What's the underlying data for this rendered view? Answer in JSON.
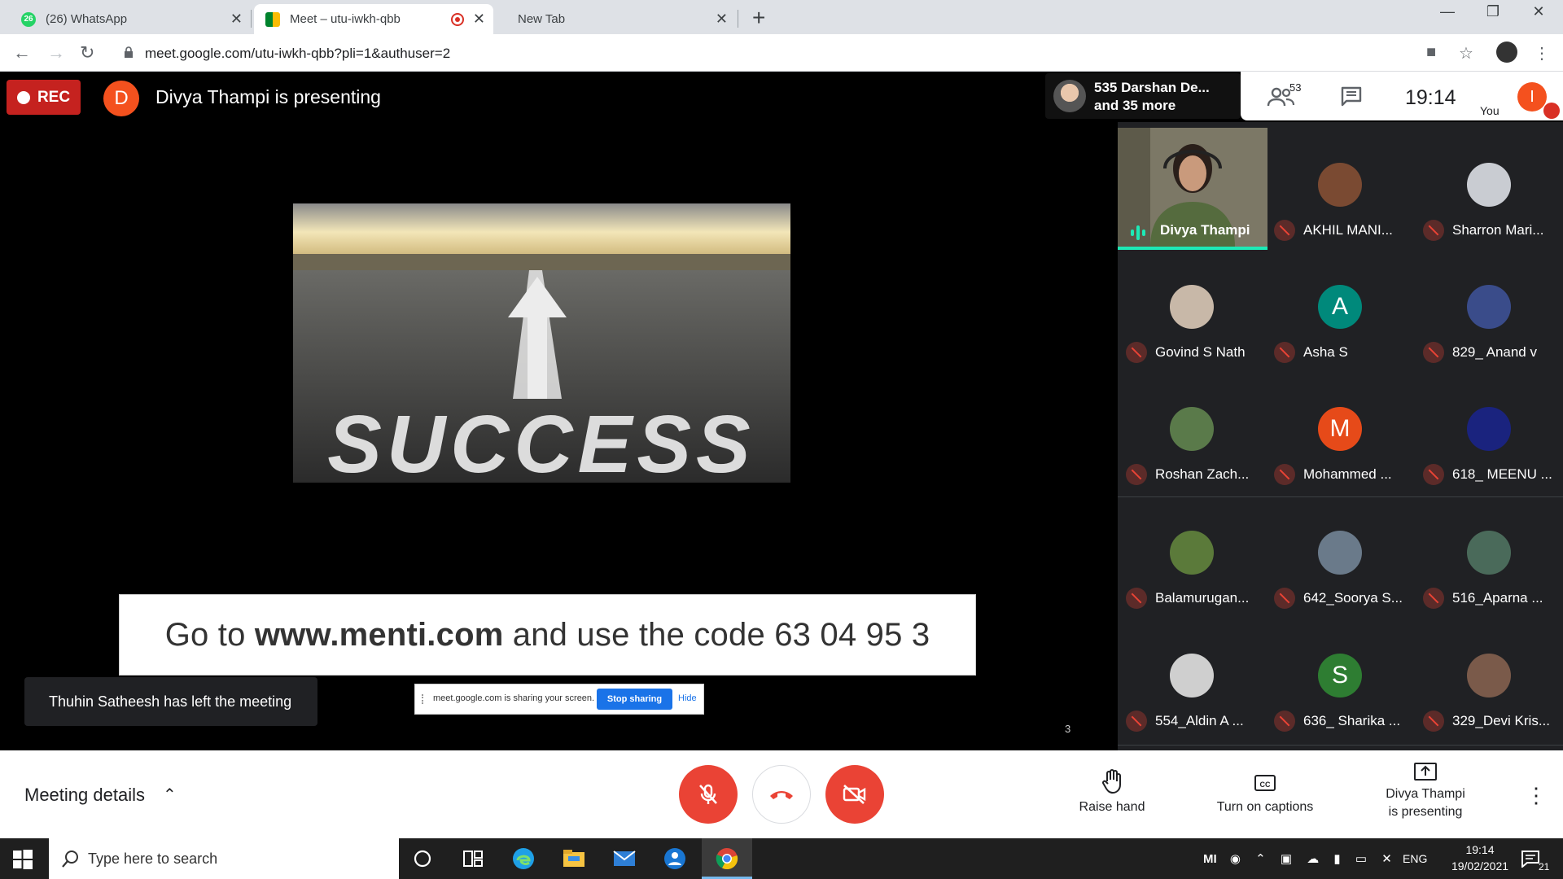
{
  "browser": {
    "tabs": [
      {
        "title": "(26) WhatsApp",
        "badge": "26"
      },
      {
        "title": "Meet – utu-iwkh-qbb"
      },
      {
        "title": "New Tab"
      }
    ],
    "url": "meet.google.com/utu-iwkh-qbb?pli=1&authuser=2"
  },
  "meet": {
    "rec_label": "REC",
    "presenter_initial": "D",
    "presenting_title": "Divya Thampi is presenting",
    "attendee_name": "535 Darshan De...",
    "attendee_more": "and 35 more",
    "people_count": "53",
    "clock": "19:14",
    "you_label": "You",
    "you_initial": "I"
  },
  "slide": {
    "banner_prefix": "Go to ",
    "banner_url": "www.menti.com",
    "banner_mid": " and use the code ",
    "banner_code": "63 04 95 3",
    "slide_number": "3",
    "image_word": "SUCCESS"
  },
  "toast": "Thuhin Satheesh has left the meeting",
  "share_bar": {
    "text": "meet.google.com is sharing your screen.",
    "stop": "Stop sharing",
    "hide": "Hide"
  },
  "speaker": {
    "name": "Divya Thampi"
  },
  "participants": [
    {
      "name": "AKHIL MANI...",
      "initial": "",
      "color": "#7a4a32"
    },
    {
      "name": "Sharron Mari...",
      "initial": "",
      "color": "#c9ccd2"
    },
    {
      "name": "Govind S Nath",
      "initial": "",
      "color": "#c8b8a8"
    },
    {
      "name": "Asha S",
      "initial": "A",
      "color": "#00897b"
    },
    {
      "name": "829_ Anand v",
      "initial": "",
      "color": "#3a4c8a"
    },
    {
      "name": "Roshan Zach...",
      "initial": "",
      "color": "#5a7a4a"
    },
    {
      "name": "Mohammed ...",
      "initial": "M",
      "color": "#e64a19"
    },
    {
      "name": "618_ MEENU ...",
      "initial": "",
      "color": "#1a237e"
    },
    {
      "name": "Balamurugan...",
      "initial": "",
      "color": "#5b7a3a"
    },
    {
      "name": "642_Soorya S...",
      "initial": "",
      "color": "#6a7a8a"
    },
    {
      "name": "516_Aparna ...",
      "initial": "",
      "color": "#4a6a5a"
    },
    {
      "name": "554_Aldin A ...",
      "initial": "",
      "color": "#cfcfcf"
    },
    {
      "name": "636_ Sharika ...",
      "initial": "S",
      "color": "#2e7d32"
    },
    {
      "name": "329_Devi Kris...",
      "initial": "",
      "color": "#7a5a4a"
    }
  ],
  "controls": {
    "meeting_details": "Meeting details",
    "raise_hand": "Raise hand",
    "captions": "Turn on captions",
    "presenting_line1": "Divya Thampi",
    "presenting_line2": "is presenting"
  },
  "taskbar": {
    "search_placeholder": "Type here to search",
    "lang": "ENG",
    "time": "19:14",
    "date": "19/02/2021",
    "notifications": "21"
  }
}
